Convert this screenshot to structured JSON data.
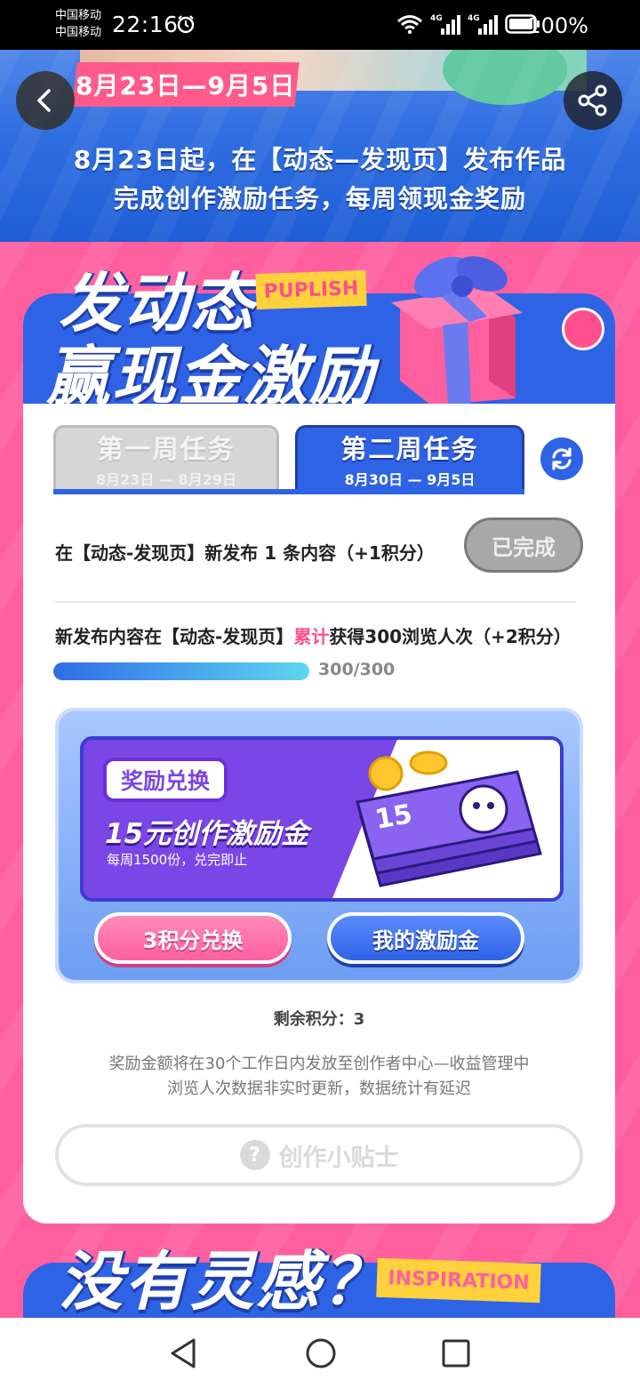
{
  "status_bar": {
    "carrier1": "中国移动",
    "carrier2": "中国移动",
    "time": "22:16",
    "battery_percent": "100%",
    "icons": [
      "alarm-icon",
      "wifi-icon",
      "signal-4g-icon",
      "signal-4g-icon",
      "battery-icon"
    ]
  },
  "hero": {
    "date_range": "8月23日—9月5日",
    "line1": "8月23日起，在【动态—发现页】发布作品",
    "line2": "完成创作激励任务，每周领现金奖励"
  },
  "banner": {
    "title_line1": "发动态",
    "title_line2": "赢现金激励",
    "tag": "PUPLISH"
  },
  "tabs": [
    {
      "title": "第一周任务",
      "dates": "8月23日 — 8月29日"
    },
    {
      "title": "第二周任务",
      "dates": "8月30日 — 9月5日"
    }
  ],
  "tasks": {
    "task1_text": "在【动态-发现页】新发布 1 条内容（+1积分）",
    "task1_button": "已完成",
    "task2_prefix": "新发布内容在【动态-发现页】",
    "task2_highlight": "累计",
    "task2_suffix": "获得300浏览人次（+2积分）",
    "task2_progress": 1.0,
    "task2_progress_text": "300/300"
  },
  "reward": {
    "pill": "奖励兑换",
    "name": "15元创作激励金",
    "note": "每周1500份，兑完即止",
    "cash_label": "15",
    "exchange_button": "3积分兑换",
    "mine_button": "我的激励金"
  },
  "footer": {
    "points": "剩余积分：3",
    "note1": "奖励金额将在30个工作日内发放至创作者中心—收益管理中",
    "note2": "浏览人次数据非实时更新，数据统计有延迟",
    "tips_button": "创作小贴士"
  },
  "banner2": {
    "title": "没有灵感？",
    "tag": "INSPIRATION"
  },
  "colors": {
    "brand_blue": "#2f63e6",
    "brand_pink": "#ff5f9f",
    "accent_yellow": "#ffd23d",
    "reward_purple": "#7b46e6"
  }
}
